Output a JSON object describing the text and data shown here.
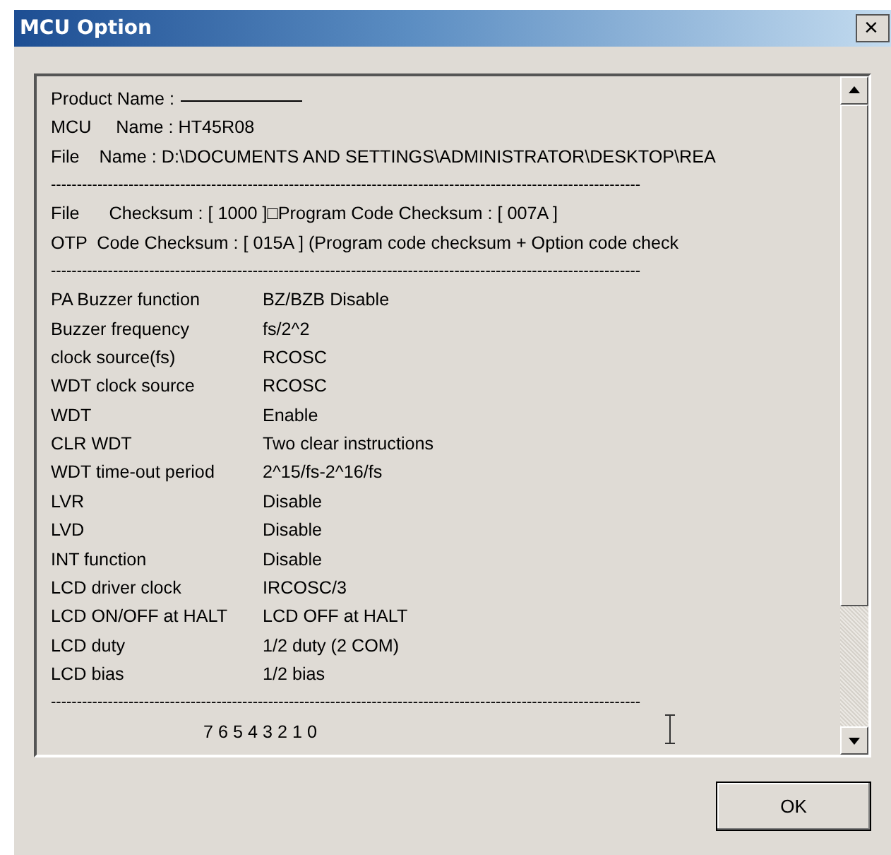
{
  "window": {
    "title": "MCU Option",
    "close": "×"
  },
  "text_box": {
    "lines": [
      {
        "kind": "field",
        "text": "Product Name :"
      },
      {
        "kind": "text",
        "text": "MCU     Name : HT45R08"
      },
      {
        "kind": "text",
        "text": "File    Name : D:\\DOCUMENTS AND SETTINGS\\ADMINISTRATOR\\DESKTOP\\REA"
      },
      {
        "kind": "rule",
        "text": "------------------------------------------------------------------------------------------------------------------"
      },
      {
        "kind": "text",
        "text": "File      Checksum : [ 1000 ]□Program Code Checksum : [ 007A ]"
      },
      {
        "kind": "text",
        "text": "OTP  Code Checksum : [ 015A ] (Program code checksum + Option code check"
      },
      {
        "kind": "rule",
        "text": "------------------------------------------------------------------------------------------------------------------"
      },
      {
        "kind": "option",
        "name": "PA Buzzer function",
        "value": "BZ/BZB Disable"
      },
      {
        "kind": "option",
        "name": "Buzzer frequency",
        "value": "fs/2^2"
      },
      {
        "kind": "option",
        "name": "clock source(fs)",
        "value": "RCOSC"
      },
      {
        "kind": "option",
        "name": "WDT clock source",
        "value": "RCOSC"
      },
      {
        "kind": "option",
        "name": "WDT",
        "value": "Enable"
      },
      {
        "kind": "option",
        "name": "CLR WDT",
        "value": "Two clear instructions"
      },
      {
        "kind": "option",
        "name": "WDT time-out period",
        "value": "2^15/fs-2^16/fs"
      },
      {
        "kind": "option",
        "name": "LVR",
        "value": "Disable"
      },
      {
        "kind": "option",
        "name": "LVD",
        "value": "Disable"
      },
      {
        "kind": "option",
        "name": "INT function",
        "value": "Disable"
      },
      {
        "kind": "option",
        "name": "LCD driver clock",
        "value": "IRCOSC/3"
      },
      {
        "kind": "option",
        "name": "LCD ON/OFF at HALT",
        "value": "LCD OFF at HALT"
      },
      {
        "kind": "option",
        "name": "LCD duty",
        "value": "1/2 duty (2 COM)"
      },
      {
        "kind": "option",
        "name": "LCD bias",
        "value": "1/2 bias"
      },
      {
        "kind": "rule",
        "text": "------------------------------------------------------------------------------------------------------------------"
      },
      {
        "kind": "bits",
        "text": "7 6 5 4 3 2 1 0"
      }
    ]
  },
  "buttons": [
    {
      "label": "OK"
    }
  ]
}
